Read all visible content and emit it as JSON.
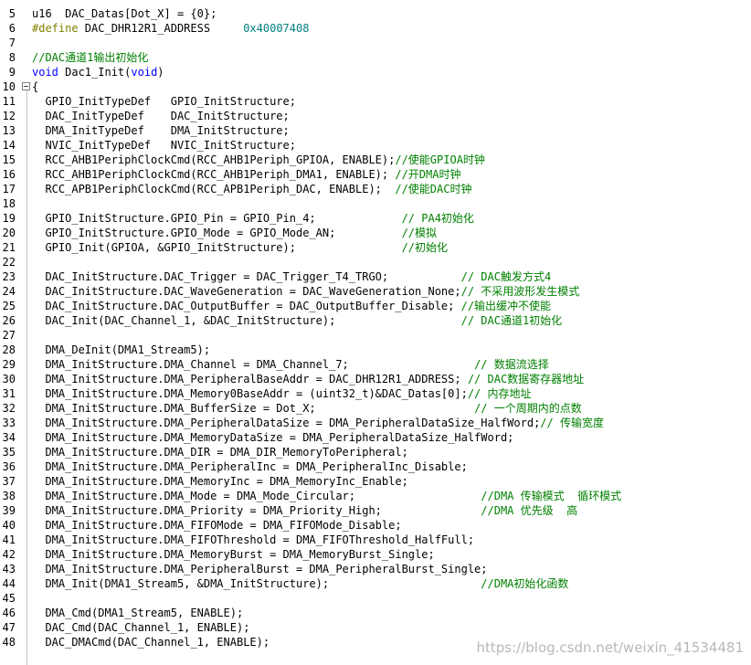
{
  "lines": [
    {
      "n": "5",
      "segs": [
        {
          "t": "u16  DAC_Datas[Dot_X] = {0};",
          "c": "plain"
        }
      ]
    },
    {
      "n": "6",
      "segs": [
        {
          "t": "#define",
          "c": "pp"
        },
        {
          "t": " DAC_DHR12R1_ADDRESS     ",
          "c": "plain"
        },
        {
          "t": "0x40007408",
          "c": "num"
        }
      ]
    },
    {
      "n": "7",
      "segs": []
    },
    {
      "n": "8",
      "segs": [
        {
          "t": "//DAC通道1输出初始化",
          "c": "cmt"
        }
      ]
    },
    {
      "n": "9",
      "segs": [
        {
          "t": "void",
          "c": "kw"
        },
        {
          "t": " Dac1_Init(",
          "c": "plain"
        },
        {
          "t": "void",
          "c": "kw"
        },
        {
          "t": ")",
          "c": "plain"
        }
      ]
    },
    {
      "n": "10",
      "segs": [
        {
          "t": "{",
          "c": "plain"
        }
      ]
    },
    {
      "n": "11",
      "segs": [
        {
          "t": "  GPIO_InitTypeDef   GPIO_InitStructure;",
          "c": "plain"
        }
      ]
    },
    {
      "n": "12",
      "segs": [
        {
          "t": "  DAC_InitTypeDef    DAC_InitStructure;",
          "c": "plain"
        }
      ]
    },
    {
      "n": "13",
      "segs": [
        {
          "t": "  DMA_InitTypeDef    DMA_InitStructure;",
          "c": "plain"
        }
      ]
    },
    {
      "n": "14",
      "segs": [
        {
          "t": "  NVIC_InitTypeDef   NVIC_InitStructure;",
          "c": "plain"
        }
      ]
    },
    {
      "n": "15",
      "segs": [
        {
          "t": "  RCC_AHB1PeriphClockCmd(RCC_AHB1Periph_GPIOA, ENABLE);",
          "c": "plain"
        },
        {
          "t": "//使能GPIOA时钟",
          "c": "cmt"
        }
      ]
    },
    {
      "n": "16",
      "segs": [
        {
          "t": "  RCC_AHB1PeriphClockCmd(RCC_AHB1Periph_DMA1, ENABLE); ",
          "c": "plain"
        },
        {
          "t": "//开DMA时钟",
          "c": "cmt"
        }
      ]
    },
    {
      "n": "17",
      "segs": [
        {
          "t": "  RCC_APB1PeriphClockCmd(RCC_APB1Periph_DAC, ENABLE);  ",
          "c": "plain"
        },
        {
          "t": "//使能DAC时钟",
          "c": "cmt"
        }
      ]
    },
    {
      "n": "18",
      "segs": []
    },
    {
      "n": "19",
      "segs": [
        {
          "t": "  GPIO_InitStructure.GPIO_Pin = GPIO_Pin_4;             ",
          "c": "plain"
        },
        {
          "t": "// PA4初始化",
          "c": "cmt"
        }
      ]
    },
    {
      "n": "20",
      "segs": [
        {
          "t": "  GPIO_InitStructure.GPIO_Mode = GPIO_Mode_AN;          ",
          "c": "plain"
        },
        {
          "t": "//模拟",
          "c": "cmt"
        }
      ]
    },
    {
      "n": "21",
      "segs": [
        {
          "t": "  GPIO_Init(GPIOA, &GPIO_InitStructure);                ",
          "c": "plain"
        },
        {
          "t": "//初始化",
          "c": "cmt"
        }
      ]
    },
    {
      "n": "22",
      "segs": []
    },
    {
      "n": "23",
      "segs": [
        {
          "t": "  DAC_InitStructure.DAC_Trigger = DAC_Trigger_T4_TRGO;           ",
          "c": "plain"
        },
        {
          "t": "// DAC触发方式4",
          "c": "cmt"
        }
      ]
    },
    {
      "n": "24",
      "segs": [
        {
          "t": "  DAC_InitStructure.DAC_WaveGeneration = DAC_WaveGeneration_None;",
          "c": "plain"
        },
        {
          "t": "// 不采用波形发生模式",
          "c": "cmt"
        }
      ]
    },
    {
      "n": "25",
      "segs": [
        {
          "t": "  DAC_InitStructure.DAC_OutputBuffer = DAC_OutputBuffer_Disable; ",
          "c": "plain"
        },
        {
          "t": "//输出缓冲不使能",
          "c": "cmt"
        }
      ]
    },
    {
      "n": "26",
      "segs": [
        {
          "t": "  DAC_Init(DAC_Channel_1, &DAC_InitStructure);                   ",
          "c": "plain"
        },
        {
          "t": "// DAC通道1初始化",
          "c": "cmt"
        }
      ]
    },
    {
      "n": "27",
      "segs": []
    },
    {
      "n": "28",
      "segs": [
        {
          "t": "  DMA_DeInit(DMA1_Stream5);",
          "c": "plain"
        }
      ]
    },
    {
      "n": "29",
      "segs": [
        {
          "t": "  DMA_InitStructure.DMA_Channel = DMA_Channel_7;                   ",
          "c": "plain"
        },
        {
          "t": "// 数据流选择",
          "c": "cmt"
        }
      ]
    },
    {
      "n": "30",
      "segs": [
        {
          "t": "  DMA_InitStructure.DMA_PeripheralBaseAddr = DAC_DHR12R1_ADDRESS; ",
          "c": "plain"
        },
        {
          "t": "// DAC数据寄存器地址",
          "c": "cmt"
        }
      ]
    },
    {
      "n": "31",
      "segs": [
        {
          "t": "  DMA_InitStructure.DMA_Memory0BaseAddr = (uint32_t)&DAC_Datas[0];",
          "c": "plain"
        },
        {
          "t": "// 内存地址",
          "c": "cmt"
        }
      ]
    },
    {
      "n": "32",
      "segs": [
        {
          "t": "  DMA_InitStructure.DMA_BufferSize = Dot_X;                        ",
          "c": "plain"
        },
        {
          "t": "// 一个周期内的点数",
          "c": "cmt"
        }
      ]
    },
    {
      "n": "33",
      "segs": [
        {
          "t": "  DMA_InitStructure.DMA_PeripheralDataSize = DMA_PeripheralDataSize_HalfWord;",
          "c": "plain"
        },
        {
          "t": "// 传输宽度",
          "c": "cmt"
        }
      ]
    },
    {
      "n": "34",
      "segs": [
        {
          "t": "  DMA_InitStructure.DMA_MemoryDataSize = DMA_PeripheralDataSize_HalfWord;",
          "c": "plain"
        }
      ]
    },
    {
      "n": "35",
      "segs": [
        {
          "t": "  DMA_InitStructure.DMA_DIR = DMA_DIR_MemoryToPeripheral;",
          "c": "plain"
        }
      ]
    },
    {
      "n": "36",
      "segs": [
        {
          "t": "  DMA_InitStructure.DMA_PeripheralInc = DMA_PeripheralInc_Disable;",
          "c": "plain"
        }
      ]
    },
    {
      "n": "37",
      "segs": [
        {
          "t": "  DMA_InitStructure.DMA_MemoryInc = DMA_MemoryInc_Enable;",
          "c": "plain"
        }
      ]
    },
    {
      "n": "38",
      "segs": [
        {
          "t": "  DMA_InitStructure.DMA_Mode = DMA_Mode_Circular;                   ",
          "c": "plain"
        },
        {
          "t": "//DMA 传输模式  循环模式",
          "c": "cmt"
        }
      ]
    },
    {
      "n": "39",
      "segs": [
        {
          "t": "  DMA_InitStructure.DMA_Priority = DMA_Priority_High;               ",
          "c": "plain"
        },
        {
          "t": "//DMA 优先级  高",
          "c": "cmt"
        }
      ]
    },
    {
      "n": "40",
      "segs": [
        {
          "t": "  DMA_InitStructure.DMA_FIFOMode = DMA_FIFOMode_Disable;",
          "c": "plain"
        }
      ]
    },
    {
      "n": "41",
      "segs": [
        {
          "t": "  DMA_InitStructure.DMA_FIFOThreshold = DMA_FIFOThreshold_HalfFull;",
          "c": "plain"
        }
      ]
    },
    {
      "n": "42",
      "segs": [
        {
          "t": "  DMA_InitStructure.DMA_MemoryBurst = DMA_MemoryBurst_Single;",
          "c": "plain"
        }
      ]
    },
    {
      "n": "43",
      "segs": [
        {
          "t": "  DMA_InitStructure.DMA_PeripheralBurst = DMA_PeripheralBurst_Single;",
          "c": "plain"
        }
      ]
    },
    {
      "n": "44",
      "segs": [
        {
          "t": "  DMA_Init(DMA1_Stream5, &DMA_InitStructure);                       ",
          "c": "plain"
        },
        {
          "t": "//DMA初始化函数",
          "c": "cmt"
        }
      ]
    },
    {
      "n": "45",
      "segs": []
    },
    {
      "n": "46",
      "segs": [
        {
          "t": "  DMA_Cmd(DMA1_Stream5, ENABLE);",
          "c": "plain"
        }
      ]
    },
    {
      "n": "47",
      "segs": [
        {
          "t": "  DAC_Cmd(DAC_Channel_1, ENABLE);",
          "c": "plain"
        }
      ]
    },
    {
      "n": "48",
      "segs": [
        {
          "t": "  DAC_DMACmd(DAC_Channel_1, ENABLE);",
          "c": "plain"
        }
      ]
    }
  ],
  "watermark": "https://blog.csdn.net/weixin_41534481",
  "fold_icon": "collapse-minus-icon"
}
